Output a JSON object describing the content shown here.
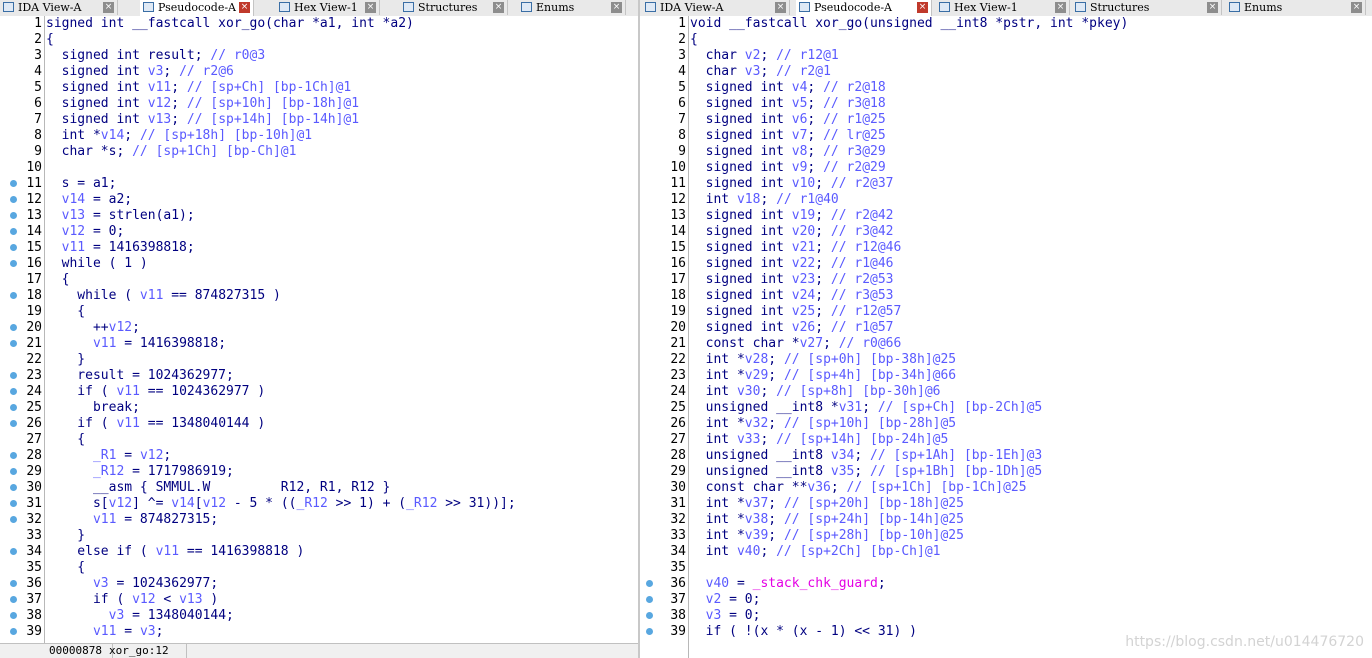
{
  "left_tabs": [
    {
      "label": "IDA View-A",
      "icon": "ida-view-icon",
      "active": false
    },
    {
      "label": "Pseudocode-A",
      "icon": "pseudocode-icon",
      "active": true
    },
    {
      "label": "Hex View-1",
      "icon": "hex-view-icon",
      "active": false
    },
    {
      "label": "Structures",
      "icon": "structures-icon",
      "active": false
    },
    {
      "label": "Enums",
      "icon": "enums-icon",
      "active": false
    }
  ],
  "right_tabs": [
    {
      "label": "IDA View-A",
      "icon": "ida-view-icon",
      "active": false
    },
    {
      "label": "Pseudocode-A",
      "icon": "pseudocode-icon",
      "active": true
    },
    {
      "label": "Hex View-1",
      "icon": "hex-view-icon",
      "active": false
    },
    {
      "label": "Structures",
      "icon": "structures-icon",
      "active": false
    },
    {
      "label": "Enums",
      "icon": "enums-icon",
      "active": false
    }
  ],
  "left_code": [
    {
      "n": "1",
      "bp": false,
      "t": "signed int __fastcall xor_go(char *a1, int *a2)"
    },
    {
      "n": "2",
      "bp": false,
      "t": "{"
    },
    {
      "n": "3",
      "bp": false,
      "t": "  signed int result; // r0@3"
    },
    {
      "n": "4",
      "bp": false,
      "t": "  signed int v3; // r2@6"
    },
    {
      "n": "5",
      "bp": false,
      "t": "  signed int v11; // [sp+Ch] [bp-1Ch]@1"
    },
    {
      "n": "6",
      "bp": false,
      "t": "  signed int v12; // [sp+10h] [bp-18h]@1"
    },
    {
      "n": "7",
      "bp": false,
      "t": "  signed int v13; // [sp+14h] [bp-14h]@1"
    },
    {
      "n": "8",
      "bp": false,
      "t": "  int *v14; // [sp+18h] [bp-10h]@1"
    },
    {
      "n": "9",
      "bp": false,
      "t": "  char *s; // [sp+1Ch] [bp-Ch]@1"
    },
    {
      "n": "10",
      "bp": false,
      "t": ""
    },
    {
      "n": "11",
      "bp": true,
      "t": "  s = a1;"
    },
    {
      "n": "12",
      "bp": true,
      "t": "  v14 = a2;"
    },
    {
      "n": "13",
      "bp": true,
      "t": "  v13 = strlen(a1);"
    },
    {
      "n": "14",
      "bp": true,
      "t": "  v12 = 0;"
    },
    {
      "n": "15",
      "bp": true,
      "t": "  v11 = 1416398818;"
    },
    {
      "n": "16",
      "bp": true,
      "t": "  while ( 1 )"
    },
    {
      "n": "17",
      "bp": false,
      "t": "  {"
    },
    {
      "n": "18",
      "bp": true,
      "t": "    while ( v11 == 874827315 )"
    },
    {
      "n": "19",
      "bp": false,
      "t": "    {"
    },
    {
      "n": "20",
      "bp": true,
      "t": "      ++v12;"
    },
    {
      "n": "21",
      "bp": true,
      "t": "      v11 = 1416398818;"
    },
    {
      "n": "22",
      "bp": false,
      "t": "    }"
    },
    {
      "n": "23",
      "bp": true,
      "t": "    result = 1024362977;"
    },
    {
      "n": "24",
      "bp": true,
      "t": "    if ( v11 == 1024362977 )"
    },
    {
      "n": "25",
      "bp": true,
      "t": "      break;"
    },
    {
      "n": "26",
      "bp": true,
      "t": "    if ( v11 == 1348040144 )"
    },
    {
      "n": "27",
      "bp": false,
      "t": "    {"
    },
    {
      "n": "28",
      "bp": true,
      "t": "      _R1 = v12;"
    },
    {
      "n": "29",
      "bp": true,
      "t": "      _R12 = 1717986919;"
    },
    {
      "n": "30",
      "bp": true,
      "t": "      __asm { SMMUL.W         R12, R1, R12 }"
    },
    {
      "n": "31",
      "bp": true,
      "t": "      s[v12] ^= v14[v12 - 5 * ((_R12 >> 1) + (_R12 >> 31))];"
    },
    {
      "n": "32",
      "bp": true,
      "t": "      v11 = 874827315;"
    },
    {
      "n": "33",
      "bp": false,
      "t": "    }"
    },
    {
      "n": "34",
      "bp": true,
      "t": "    else if ( v11 == 1416398818 )"
    },
    {
      "n": "35",
      "bp": false,
      "t": "    {"
    },
    {
      "n": "36",
      "bp": true,
      "t": "      v3 = 1024362977;"
    },
    {
      "n": "37",
      "bp": true,
      "t": "      if ( v12 < v13 )"
    },
    {
      "n": "38",
      "bp": true,
      "t": "        v3 = 1348040144;"
    },
    {
      "n": "39",
      "bp": true,
      "t": "      v11 = v3;"
    }
  ],
  "right_code": [
    {
      "n": "1",
      "bp": false,
      "t": "void __fastcall xor_go(unsigned __int8 *pstr, int *pkey)"
    },
    {
      "n": "2",
      "bp": false,
      "t": "{"
    },
    {
      "n": "3",
      "bp": false,
      "t": "  char v2; // r12@1"
    },
    {
      "n": "4",
      "bp": false,
      "t": "  char v3; // r2@1"
    },
    {
      "n": "5",
      "bp": false,
      "t": "  signed int v4; // r2@18"
    },
    {
      "n": "6",
      "bp": false,
      "t": "  signed int v5; // r3@18"
    },
    {
      "n": "7",
      "bp": false,
      "t": "  signed int v6; // r1@25"
    },
    {
      "n": "8",
      "bp": false,
      "t": "  signed int v7; // lr@25"
    },
    {
      "n": "9",
      "bp": false,
      "t": "  signed int v8; // r3@29"
    },
    {
      "n": "10",
      "bp": false,
      "t": "  signed int v9; // r2@29"
    },
    {
      "n": "11",
      "bp": false,
      "t": "  signed int v10; // r2@37"
    },
    {
      "n": "12",
      "bp": false,
      "t": "  int v18; // r1@40"
    },
    {
      "n": "13",
      "bp": false,
      "t": "  signed int v19; // r2@42"
    },
    {
      "n": "14",
      "bp": false,
      "t": "  signed int v20; // r3@42"
    },
    {
      "n": "15",
      "bp": false,
      "t": "  signed int v21; // r12@46"
    },
    {
      "n": "16",
      "bp": false,
      "t": "  signed int v22; // r1@46"
    },
    {
      "n": "17",
      "bp": false,
      "t": "  signed int v23; // r2@53"
    },
    {
      "n": "18",
      "bp": false,
      "t": "  signed int v24; // r3@53"
    },
    {
      "n": "19",
      "bp": false,
      "t": "  signed int v25; // r12@57"
    },
    {
      "n": "20",
      "bp": false,
      "t": "  signed int v26; // r1@57"
    },
    {
      "n": "21",
      "bp": false,
      "t": "  const char *v27; // r0@66"
    },
    {
      "n": "22",
      "bp": false,
      "t": "  int *v28; // [sp+0h] [bp-38h]@25"
    },
    {
      "n": "23",
      "bp": false,
      "t": "  int *v29; // [sp+4h] [bp-34h]@66"
    },
    {
      "n": "24",
      "bp": false,
      "t": "  int v30; // [sp+8h] [bp-30h]@6"
    },
    {
      "n": "25",
      "bp": false,
      "t": "  unsigned __int8 *v31; // [sp+Ch] [bp-2Ch]@5"
    },
    {
      "n": "26",
      "bp": false,
      "t": "  int *v32; // [sp+10h] [bp-28h]@5"
    },
    {
      "n": "27",
      "bp": false,
      "t": "  int v33; // [sp+14h] [bp-24h]@5"
    },
    {
      "n": "28",
      "bp": false,
      "t": "  unsigned __int8 v34; // [sp+1Ah] [bp-1Eh]@3"
    },
    {
      "n": "29",
      "bp": false,
      "t": "  unsigned __int8 v35; // [sp+1Bh] [bp-1Dh]@5"
    },
    {
      "n": "30",
      "bp": false,
      "t": "  const char **v36; // [sp+1Ch] [bp-1Ch]@25"
    },
    {
      "n": "31",
      "bp": false,
      "t": "  int *v37; // [sp+20h] [bp-18h]@25"
    },
    {
      "n": "32",
      "bp": false,
      "t": "  int *v38; // [sp+24h] [bp-14h]@25"
    },
    {
      "n": "33",
      "bp": false,
      "t": "  int *v39; // [sp+28h] [bp-10h]@25"
    },
    {
      "n": "34",
      "bp": false,
      "t": "  int v40; // [sp+2Ch] [bp-Ch]@1"
    },
    {
      "n": "35",
      "bp": false,
      "t": ""
    },
    {
      "n": "36",
      "bp": true,
      "t": "  v40 = _stack_chk_guard;"
    },
    {
      "n": "37",
      "bp": true,
      "t": "  v2 = 0;"
    },
    {
      "n": "38",
      "bp": true,
      "t": "  v3 = 0;"
    },
    {
      "n": "39",
      "bp": true,
      "t": "  if ( !(x * (x - 1) << 31) )"
    }
  ],
  "left_status": {
    "address": "00000878",
    "location": "xor_go:12"
  },
  "watermark": "https://blog.csdn.net/u014476720"
}
